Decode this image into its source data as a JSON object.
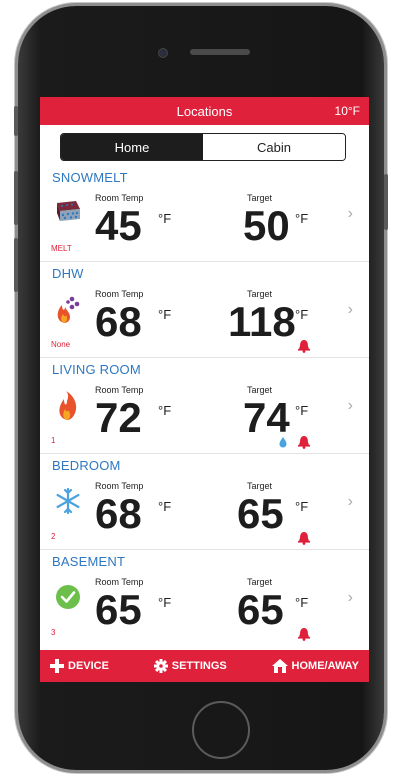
{
  "header": {
    "title": "Locations",
    "outdoor_temp": "10°F"
  },
  "tabs": [
    {
      "label": "Home",
      "active": true
    },
    {
      "label": "Cabin",
      "active": false
    }
  ],
  "labels": {
    "room_temp": "Room Temp",
    "target": "Target",
    "unit": "°F"
  },
  "zones": [
    {
      "name": "SNOWMELT",
      "icon": "snowmelt-icon",
      "room_temp": "45",
      "target": "50",
      "mode": "MELT",
      "alerts": []
    },
    {
      "name": "DHW",
      "icon": "flame-dhw-icon",
      "room_temp": "68",
      "target": "118",
      "mode": "None",
      "alerts": [
        "bell-icon"
      ]
    },
    {
      "name": "LIVING ROOM",
      "icon": "flame-icon",
      "room_temp": "72",
      "target": "74",
      "mode": "1",
      "alerts": [
        "water-drop-icon",
        "bell-icon"
      ]
    },
    {
      "name": "BEDROOM",
      "icon": "snowflake-icon",
      "room_temp": "68",
      "target": "65",
      "mode": "2",
      "alerts": [
        "bell-icon"
      ]
    },
    {
      "name": "BASEMENT",
      "icon": "check-circle-icon",
      "room_temp": "65",
      "target": "65",
      "mode": "3",
      "alerts": [
        "bell-icon"
      ]
    }
  ],
  "footer": {
    "device": "DEVICE",
    "settings": "SETTINGS",
    "home_away": "HOME/AWAY"
  },
  "colors": {
    "accent": "#e0213b",
    "zone_name": "#2e78c2",
    "segment_active": "#1d1d1d"
  }
}
